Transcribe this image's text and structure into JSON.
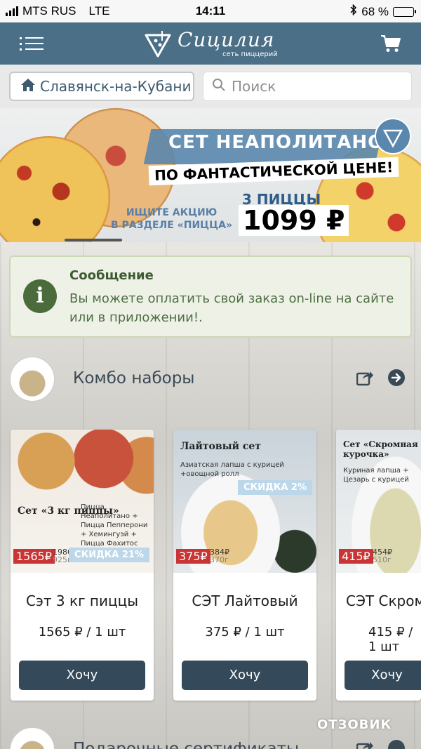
{
  "status_bar": {
    "carrier": "MTS RUS",
    "network": "LTE",
    "time": "14:11",
    "battery": "68 %",
    "battery_level": 0.68
  },
  "header": {
    "logo_name": "Сицилия",
    "logo_tagline": "сеть пиццерий"
  },
  "search_row": {
    "city": "Славянск-на-Кубани",
    "search_placeholder": "Поиск"
  },
  "banner": {
    "line1": "СЕТ НЕАПОЛИТАНО",
    "line2": "ПО ФАНТАСТИЧЕСКОЙ ЦЕНЕ!",
    "line3a": "ИЩИТЕ АКЦИЮ",
    "line3b": "В РАЗДЕЛЕ «ПИЦЦА»",
    "count": "3 ПИЦЦЫ",
    "price": "1099 ₽"
  },
  "message": {
    "title": "Сообщение",
    "text": "Вы можете оплатить свой заказ on-line на сайте или в приложении!."
  },
  "sections": [
    {
      "label": "Комбо наборы"
    },
    {
      "label": "Подарочные сертификаты"
    }
  ],
  "products": [
    {
      "promo_title": "Сет «3 кг пиццы»",
      "promo_sub": "Пицца Неаполитано + Пицца Пепперони + Хемингуэй + Пицца Фахитос",
      "discount": "СКИДКА 21%",
      "new_price": "1565₽",
      "old_price": "1986₽",
      "weight": "925г",
      "name": "Сэт 3 кг пиццы",
      "price": "1565 ₽ / 1 шт",
      "button": "Хочу"
    },
    {
      "promo_title": "Лайтовый сет",
      "promo_sub": "Азиатская лапша с курицей +овощной ролл",
      "discount": "СКИДКА 2%",
      "new_price": "375₽",
      "old_price": "384₽",
      "weight": "370г",
      "name": "СЭТ Лайтовый",
      "price": "375 ₽ / 1 шт",
      "button": "Хочу"
    },
    {
      "promo_title": "Сет «Скромная курочка»",
      "promo_sub": "Куриная лапша + Цезарь с курицей",
      "discount": "",
      "new_price": "415₽",
      "old_price": "454₽",
      "weight": "510г",
      "name": "СЭТ Скромная курочка",
      "price": "415 ₽ / 1 шт",
      "button": "Хочу"
    }
  ],
  "watermark": "ОТЗОВИК"
}
